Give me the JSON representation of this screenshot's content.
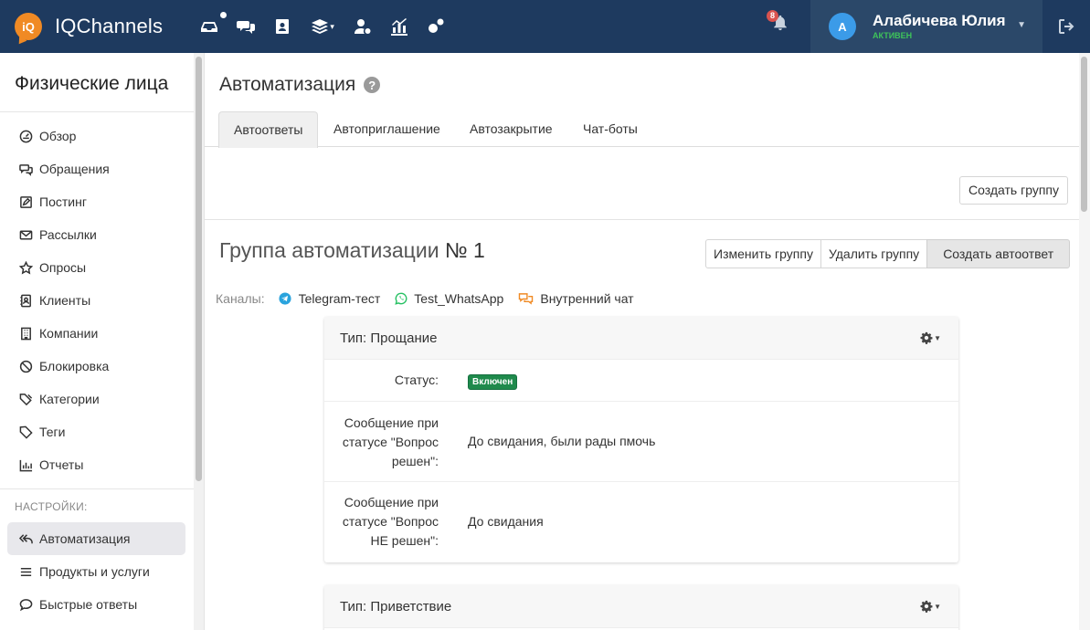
{
  "header": {
    "app_name": "IQChannels",
    "logo_mark": "iQ",
    "nav_icons": [
      "inbox-icon",
      "chat-icon",
      "contacts-icon",
      "layers-icon",
      "users-cog-icon",
      "analytics-icon",
      "settings-icon"
    ],
    "notifications_count": "8",
    "user": {
      "initial": "А",
      "name": "Алабичева Юлия",
      "status": "АКТИВЕН"
    }
  },
  "sidebar": {
    "title": "Физические лица",
    "items": [
      {
        "label": "Обзор",
        "icon": "dashboard-icon"
      },
      {
        "label": "Обращения",
        "icon": "chats-icon"
      },
      {
        "label": "Постинг",
        "icon": "edit-icon"
      },
      {
        "label": "Рассылки",
        "icon": "mail-icon"
      },
      {
        "label": "Опросы",
        "icon": "star-icon"
      },
      {
        "label": "Клиенты",
        "icon": "address-book-icon"
      },
      {
        "label": "Компании",
        "icon": "building-icon"
      },
      {
        "label": "Блокировка",
        "icon": "ban-icon"
      },
      {
        "label": "Категории",
        "icon": "tags-icon"
      },
      {
        "label": "Теги",
        "icon": "tag-icon"
      },
      {
        "label": "Отчеты",
        "icon": "bar-chart-icon"
      }
    ],
    "settings_label": "НАСТРОЙКИ:",
    "settings_items": [
      {
        "label": "Автоматизация",
        "icon": "reply-all-icon",
        "active": true
      },
      {
        "label": "Продукты и услуги",
        "icon": "list-icon"
      },
      {
        "label": "Быстрые ответы",
        "icon": "comment-dots-icon"
      }
    ]
  },
  "main": {
    "title": "Автоматизация",
    "help": "?",
    "tabs": [
      "Автоответы",
      "Автоприглашение",
      "Автозакрытие",
      "Чат-боты"
    ],
    "create_group_label": "Создать группу",
    "group": {
      "title_prefix": "Группа автоматизации",
      "title_number": "№ 1",
      "edit_label": "Изменить группу",
      "delete_label": "Удалить группу",
      "create_autoreply_label": "Создать автоответ",
      "channels_label": "Каналы:",
      "channels": [
        {
          "name": "Telegram-тест",
          "icon": "telegram-icon"
        },
        {
          "name": "Test_WhatsApp",
          "icon": "whatsapp-icon"
        },
        {
          "name": "Внутренний чат",
          "icon": "internal-chat-icon"
        }
      ]
    },
    "cards": [
      {
        "title": "Тип: Прощание",
        "status_label": "Статус:",
        "status_value": "Включен",
        "resolved_label_1": "Сообщение при",
        "resolved_label_2": "статусе \"Вопрос",
        "resolved_label_3": "решен\":",
        "resolved_value": "До свидания, были рады пмочь",
        "unresolved_label_1": "Сообщение при",
        "unresolved_label_2": "статусе \"Вопрос",
        "unresolved_label_3": "НЕ решен\":",
        "unresolved_value": "До свидания"
      },
      {
        "title": "Тип: Приветствие"
      }
    ]
  },
  "colors": {
    "topbar": "#1e3a5f",
    "user_box": "#2b4869",
    "status_active": "#3ec35a",
    "badge_green": "#1f8a4c",
    "logo": "#f08a24"
  }
}
